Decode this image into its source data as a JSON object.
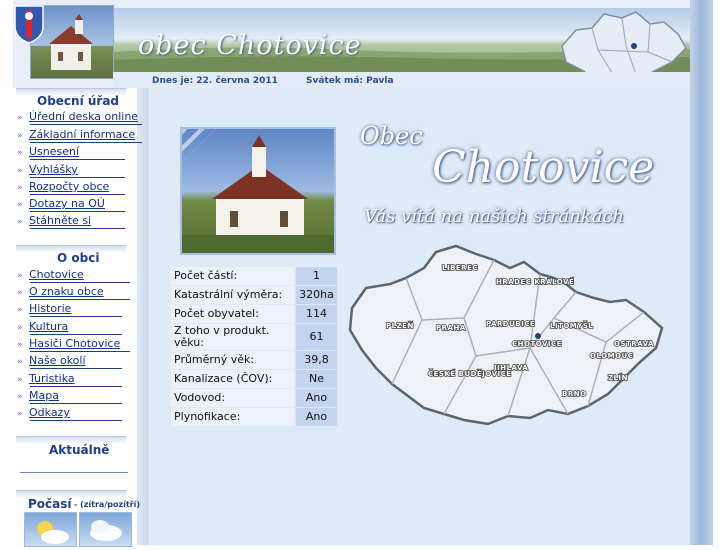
{
  "header": {
    "title": "obec Chotovice",
    "date_text": "Dnes je: 22. června 2011",
    "nameday_text": "Svátek má: Pavla"
  },
  "sidebar": {
    "sections": [
      {
        "title": "Obecní úřad",
        "items": [
          {
            "label": "Úřední deska online"
          },
          {
            "label": "Základní informace"
          },
          {
            "label": "Usnesení"
          },
          {
            "label": "Vyhlášky"
          },
          {
            "label": "Rozpočty obce"
          },
          {
            "label": "Dotazy na OÚ"
          },
          {
            "label": "Stáhněte si"
          }
        ]
      },
      {
        "title": "O obci",
        "items": [
          {
            "label": "Chotovice"
          },
          {
            "label": "O znaku obce"
          },
          {
            "label": "Historie"
          },
          {
            "label": "Kultura"
          },
          {
            "label": "Hasiči Chotovice"
          },
          {
            "label": "Naše okolí"
          },
          {
            "label": "Turistika"
          },
          {
            "label": "Mapa"
          },
          {
            "label": "Odkazy"
          }
        ]
      }
    ],
    "news_title": "Aktuálně",
    "weather_title": "Počasí",
    "weather_sub": "- (zítra/pozítří)"
  },
  "welcome": {
    "line1": "Obec",
    "line2": "Chotovice",
    "line3": "Vás vítá na našich stránkách"
  },
  "stats": [
    {
      "label": "Počet částí:",
      "value": "1"
    },
    {
      "label": "Katastrální výměra:",
      "value": "320ha"
    },
    {
      "label": "Počet obyvatel:",
      "value": "114"
    },
    {
      "label": "Z toho v produkt. věku:",
      "value": "61"
    },
    {
      "label": "Průměrný věk:",
      "value": "39,8"
    },
    {
      "label": "Kanalizace (ČOV):",
      "value": "Ne"
    },
    {
      "label": "Vodovod:",
      "value": "Ano"
    },
    {
      "label": "Plynofikace:",
      "value": "Ano"
    }
  ],
  "map": {
    "regions": [
      "LIBEREC",
      "HRADEC KRÁLOVÉ",
      "PLZEŇ",
      "PRAHA",
      "PARDUBICE",
      "LITOMYŠL",
      "CHOTOVICE",
      "OSTRAVA",
      "OLOMOUC",
      "JIHLAVA",
      "ČESKÉ BUDĚJOVICE",
      "ZLÍN",
      "BRNO"
    ]
  },
  "colors": {
    "accent": "#1f3f8b",
    "main_bg": "#ddebf8",
    "value_cell": "#c3d4ee"
  },
  "icons": {
    "nav_bullet": "double-arrow-icon",
    "crest": "coat-of-arms-icon"
  }
}
